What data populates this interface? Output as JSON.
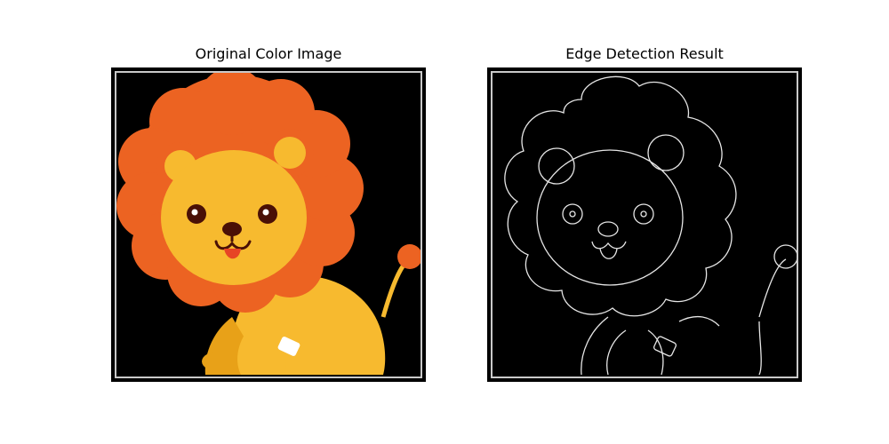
{
  "figure": {
    "panels": [
      {
        "title": "Original Color Image",
        "image": "cartoon-lion-color"
      },
      {
        "title": "Edge Detection Result",
        "image": "cartoon-lion-edges"
      }
    ]
  },
  "colors": {
    "mane": "#ec6322",
    "face": "#f7ba2f",
    "ear_inner": "#f7ba2f",
    "eye": "#4a1006",
    "tongue": "#e74425",
    "paw_patch": "#ffffff",
    "edges": "#e6e6e6",
    "background": "#000000",
    "frame_inner": "#c9c9c9"
  }
}
